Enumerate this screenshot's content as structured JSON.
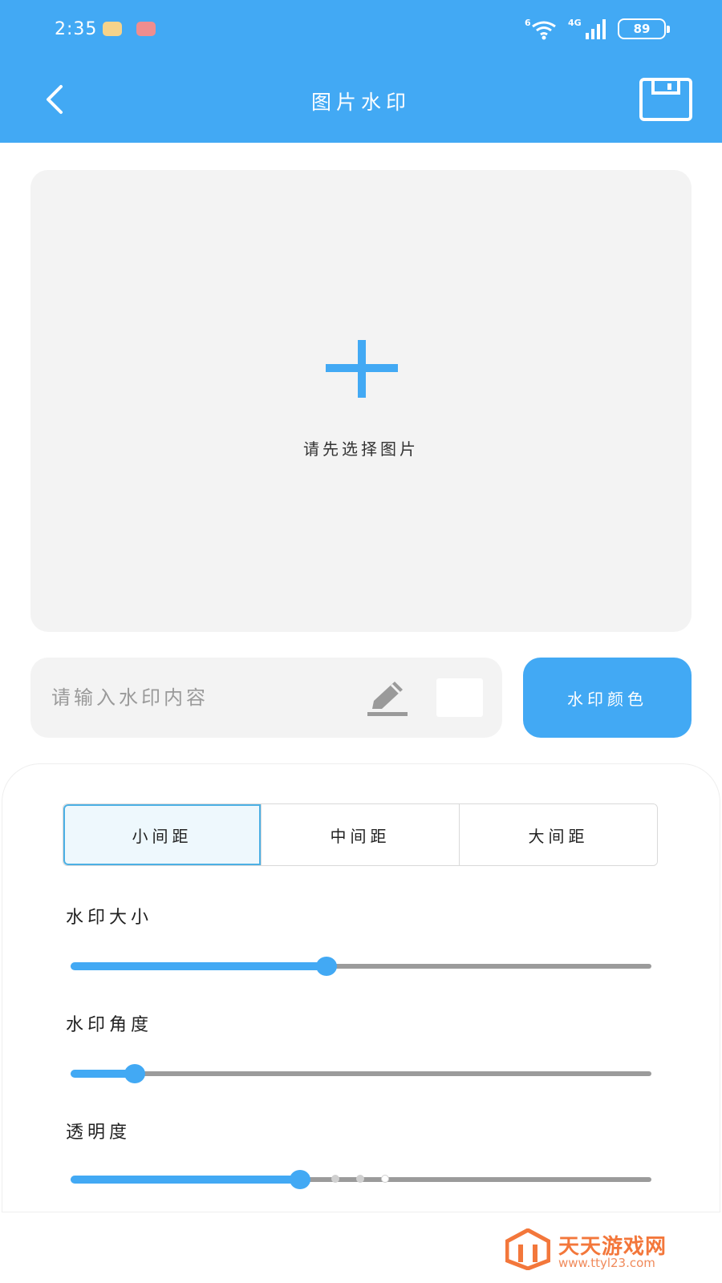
{
  "status_bar": {
    "time": "2:35",
    "wifi_badge": "6",
    "network": "4G",
    "battery": "89"
  },
  "header": {
    "title": "图片水印",
    "back_icon": "chevron-left-icon",
    "save_icon": "floppy-disk-icon"
  },
  "image_picker": {
    "icon": "plus-icon",
    "label": "请先选择图片"
  },
  "watermark_input": {
    "placeholder": "请输入水印内容",
    "value": "",
    "edit_icon": "pencil-icon",
    "swatch_color": "#ffffff"
  },
  "color_button": {
    "label": "水印颜色"
  },
  "spacing_options": [
    {
      "label": "小间距",
      "selected": true
    },
    {
      "label": "中间距",
      "selected": false
    },
    {
      "label": "大间距",
      "selected": false
    }
  ],
  "sliders": [
    {
      "label": "水印大小",
      "value": 0.44
    },
    {
      "label": "水印角度",
      "value": 0.11
    },
    {
      "label": "透明度",
      "value": 0.395
    }
  ],
  "colors": {
    "accent": "#42a9f4",
    "panel_bg": "#f3f3f3",
    "track": "#9b9b9b"
  },
  "watermark_logo": {
    "text": "天天游戏网",
    "url": "www.ttyl23.com"
  }
}
